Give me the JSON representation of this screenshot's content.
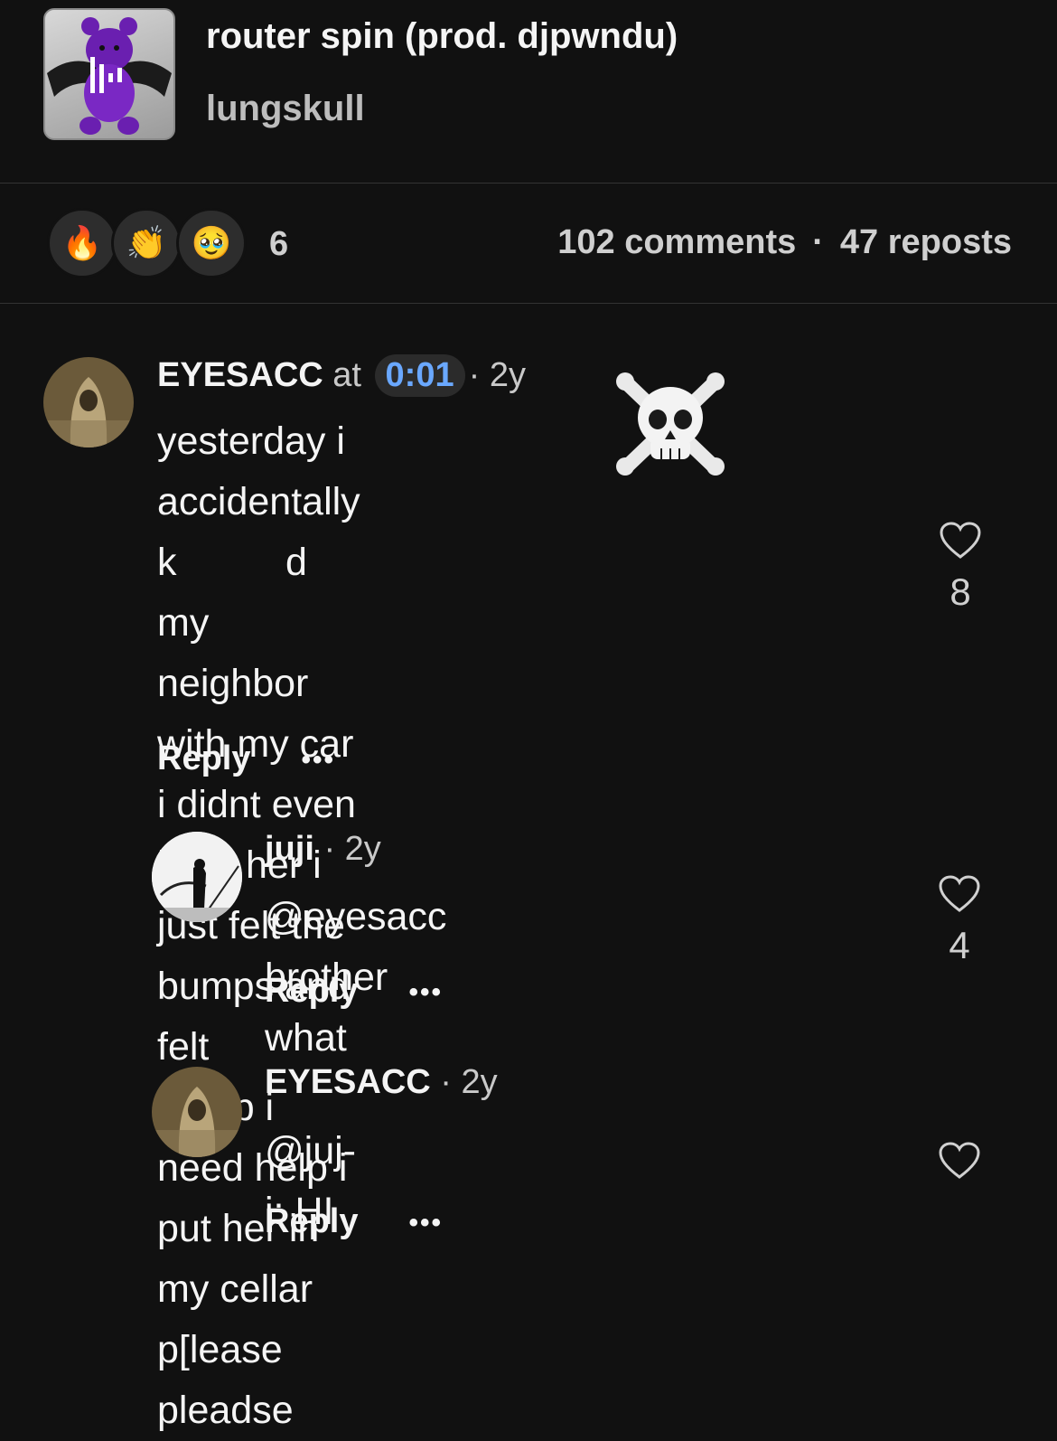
{
  "track": {
    "title": "router spin (prod. djpwndu)",
    "artist": "lungskull"
  },
  "stats": {
    "reactions": [
      {
        "icon": "fire-emoji",
        "glyph": "🔥"
      },
      {
        "icon": "clapping-hands-emoji",
        "glyph": "👏"
      },
      {
        "icon": "pleading-face-emoji",
        "glyph": "🥹"
      }
    ],
    "reaction_count": "6",
    "comments": "102 comments",
    "separator": "·",
    "reposts": "47 reposts"
  },
  "comments": [
    {
      "user": "EYESACC",
      "at": "at",
      "timestamp": "0:01",
      "age": "· 2y",
      "text": "yesterday i accidentally k d my neighbor with my car i didnt even hear her i just felt the bumps and felt a pop i need help i put her in my cellar p[lease pleadse",
      "lines": [
        "yesterday i accidentally k              d my",
        "neighbor with my car i didnt even",
        "hear her i just felt the bumps and felt",
        "a pop i need help i put her in my cellar",
        "p[lease pleadse"
      ],
      "reply": "Reply",
      "more": "•••",
      "likes": "8",
      "sticker": "skull-and-crossbones-emoji"
    },
    {
      "user": "juji",
      "age": "· 2y",
      "text": "@eyesacc brother what",
      "reply": "Reply",
      "more": "•••",
      "likes": "4"
    },
    {
      "user": "EYESACC",
      "age": "· 2y",
      "text": "@juj-i: HI",
      "reply": "Reply",
      "more": "•••"
    }
  ],
  "colors": {
    "background": "#111111",
    "timestamp_accent": "#6aa8ff",
    "divider": "#333333"
  }
}
